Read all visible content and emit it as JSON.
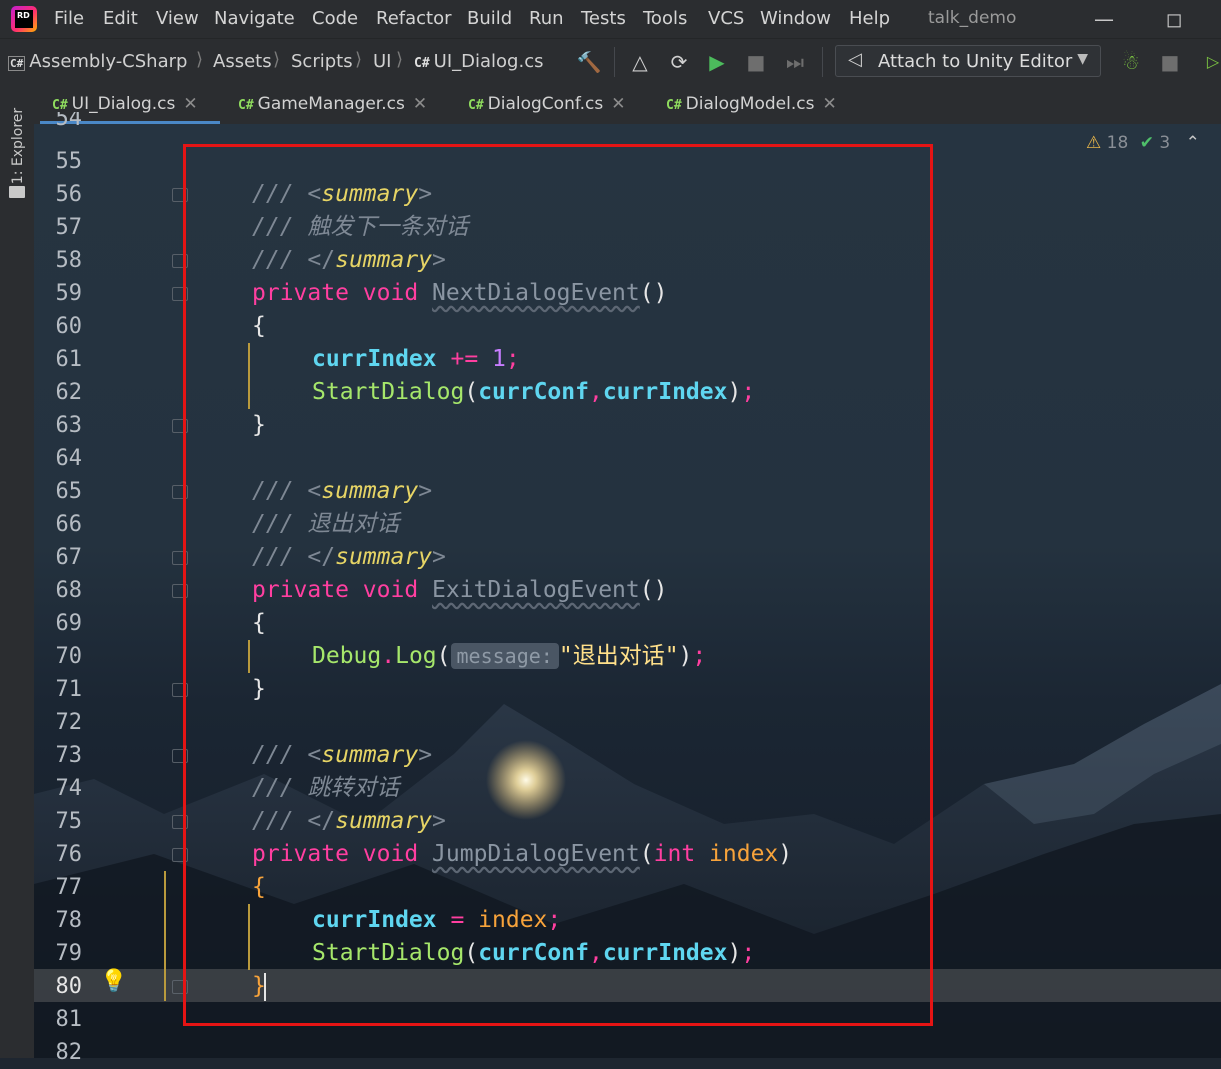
{
  "menu": {
    "items": [
      "File",
      "Edit",
      "View",
      "Navigate",
      "Code",
      "Refactor",
      "Build",
      "Run",
      "Tests",
      "Tools",
      "VCS",
      "Window",
      "Help"
    ],
    "project_title": "talk_demo"
  },
  "breadcrumb": {
    "project": "Assembly-CSharp",
    "folders": [
      "Assets",
      "Scripts",
      "UI"
    ],
    "file": "UI_Dialog.cs"
  },
  "toolbar": {
    "attach_label": "Attach to Unity Editor"
  },
  "left_strip": {
    "explorer_label": "1: Explorer"
  },
  "tabs": [
    {
      "label": "UI_Dialog.cs",
      "active": true
    },
    {
      "label": "GameManager.cs",
      "active": false
    },
    {
      "label": "DialogConf.cs",
      "active": false
    },
    {
      "label": "DialogModel.cs",
      "active": false
    }
  ],
  "lang_badge": "C#",
  "inspections": {
    "warnings": "18",
    "ok": "3"
  },
  "editor": {
    "line_numbers": [
      "54",
      "55",
      "56",
      "57",
      "58",
      "59",
      "60",
      "61",
      "62",
      "63",
      "64",
      "65",
      "66",
      "67",
      "68",
      "69",
      "70",
      "71",
      "72",
      "73",
      "74",
      "75",
      "76",
      "77",
      "78",
      "79",
      "80",
      "81",
      "82"
    ],
    "current_line": "80",
    "code": {
      "l56": {
        "slashes": "/// ",
        "open": "<",
        "tag": "summary",
        "close": ">"
      },
      "l57": {
        "text": "/// 触发下一条对话"
      },
      "l58": {
        "slashes": "/// ",
        "open": "</",
        "tag": "summary",
        "close": ">"
      },
      "l59": {
        "mod": "private",
        "type": "void",
        "name": "NextDialogEvent",
        "sig": "()"
      },
      "l60": {
        "text": "{"
      },
      "l61": {
        "field": "currIndex",
        "op": " += ",
        "num": "1",
        "end": ";"
      },
      "l62": {
        "call": "StartDialog",
        "p1": "(",
        "a1": "currConf",
        "comma": ",",
        "a2": "currIndex",
        "p2": ")",
        "end": ";"
      },
      "l63": {
        "text": "}"
      },
      "l65": {
        "slashes": "/// ",
        "open": "<",
        "tag": "summary",
        "close": ">"
      },
      "l66": {
        "text": "/// 退出对话"
      },
      "l67": {
        "slashes": "/// ",
        "open": "</",
        "tag": "summary",
        "close": ">"
      },
      "l68": {
        "mod": "private",
        "type": "void",
        "name": "ExitDialogEvent",
        "sig": "()"
      },
      "l69": {
        "text": "{"
      },
      "l70": {
        "cls": "Debug",
        "dot": ".",
        "call": "Log",
        "p1": "(",
        "hint": "message:",
        "str": "\"退出对话\"",
        "p2": ")",
        "end": ";"
      },
      "l71": {
        "text": "}"
      },
      "l73": {
        "slashes": "/// ",
        "open": "<",
        "tag": "summary",
        "close": ">"
      },
      "l74": {
        "text": "/// 跳转对话"
      },
      "l75": {
        "slashes": "/// ",
        "open": "</",
        "tag": "summary",
        "close": ">"
      },
      "l76": {
        "mod": "private",
        "type": "void",
        "name": "JumpDialogEvent",
        "p1": "(",
        "ptype": "int",
        "pname": "index",
        "p2": ")"
      },
      "l77": {
        "text": "{"
      },
      "l78": {
        "field": "currIndex",
        "op": " = ",
        "val": "index",
        "end": ";"
      },
      "l79": {
        "call": "StartDialog",
        "p1": "(",
        "a1": "currConf",
        "comma": ",",
        "a2": "currIndex",
        "p2": ")",
        "end": ";"
      },
      "l80": {
        "text": "}"
      }
    }
  },
  "colors": {
    "annotation_box": "#e51414",
    "keyword": "#ff3fa0",
    "field": "#5fd6f0",
    "method_call": "#a6e76b",
    "doc_tag": "#e6d465"
  },
  "icons": [
    "rider-logo",
    "csharp-icon",
    "build-hammer-icon",
    "unity-icon",
    "refresh-unity-icon",
    "run-icon",
    "stop-icon",
    "step-icon",
    "debug-bug-icon",
    "warning-icon",
    "check-icon",
    "chevron-up-icon",
    "lightbulb-icon",
    "folder-icon",
    "close-icon"
  ]
}
